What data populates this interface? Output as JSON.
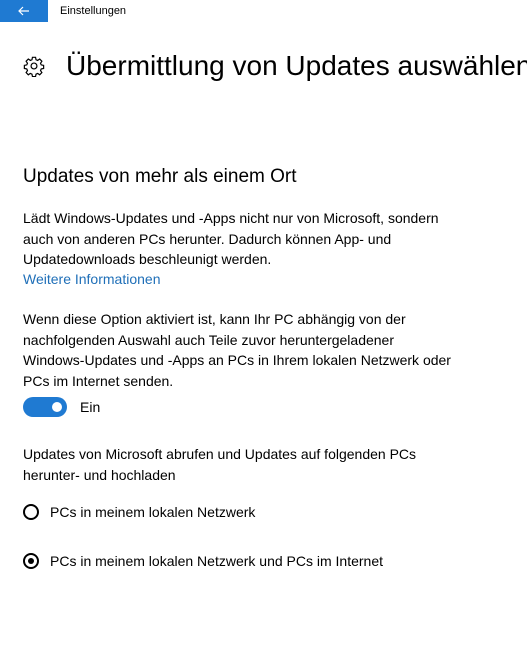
{
  "window": {
    "title": "Einstellungen",
    "back_icon": "arrow-left-icon",
    "accent_color": "#1f7ad2"
  },
  "page": {
    "title": "Übermittlung von Updates auswählen",
    "icon": "gear-icon"
  },
  "section": {
    "title": "Updates von mehr als einem Ort",
    "description": "Lädt Windows-Updates und -Apps nicht nur von Microsoft, sondern auch von anderen PCs herunter. Dadurch können App- und Updatedownloads beschleunigt werden.",
    "link": "Weitere Informationen",
    "link_color": "#1f6fb8",
    "option_description": "Wenn diese Option aktiviert ist, kann Ihr PC abhängig von der nachfolgenden Auswahl auch Teile zuvor heruntergeladener Windows-Updates und -Apps an PCs in Ihrem lokalen Netzwerk oder PCs im Internet senden.",
    "toggle": {
      "state": "on",
      "label": "Ein"
    },
    "choice_description": "Updates von Microsoft abrufen und Updates auf folgenden PCs herunter- und hochladen",
    "options": [
      {
        "label": "PCs in meinem lokalen Netzwerk",
        "selected": false
      },
      {
        "label": "PCs in meinem lokalen Netzwerk und PCs im Internet",
        "selected": true
      }
    ]
  }
}
